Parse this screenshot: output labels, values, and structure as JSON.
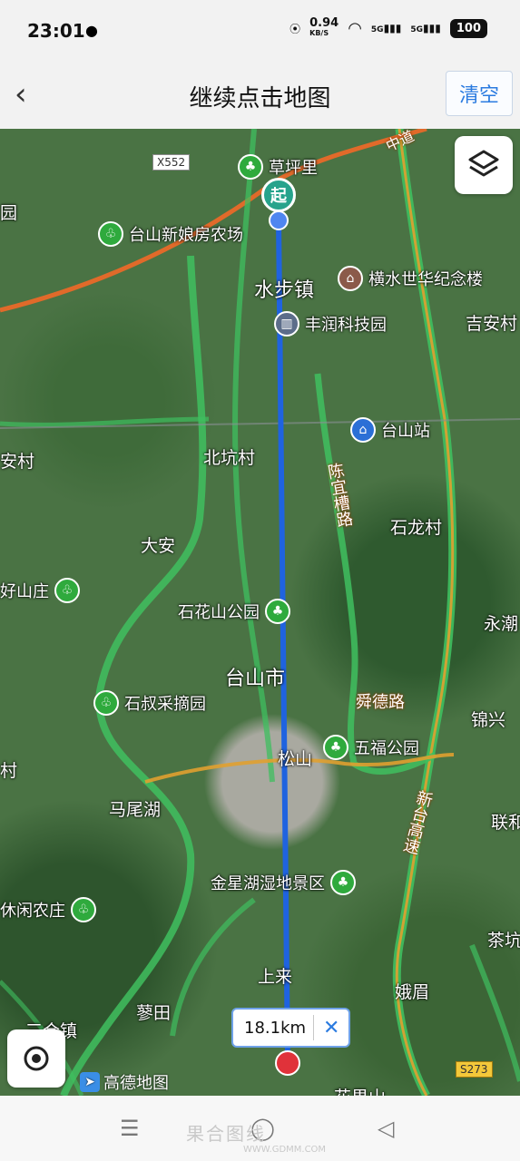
{
  "status": {
    "time": "23:01",
    "speed_value": "0.94",
    "speed_unit": "KB/S",
    "net1": "5G",
    "net2": "5G",
    "battery": "100"
  },
  "header": {
    "title": "继续点击地图",
    "clear_label": "清空"
  },
  "map": {
    "start_label": "起",
    "distance": "18.1km",
    "places": {
      "shuibu": "水步镇",
      "beikeng": "北坑村",
      "daan": "大安",
      "taishan": "台山市",
      "songshan": "松山",
      "maweihu": "马尾湖",
      "shanglai": "上来",
      "liaotian": "蓼田",
      "ejin": "娥眉",
      "shilong": "石龙村",
      "jian": "吉安村",
      "yongchao": "永潮",
      "jinxing": "锦兴",
      "lianhe": "联和",
      "chakeng": "茶坑",
      "sanhe": "三合镇",
      "huaguo": "花果山",
      "left1": "园",
      "left2": "安村",
      "left3": "村",
      "left4": "好山庄",
      "left5": "休闲农庄"
    },
    "pois": {
      "caopingli": "草坪里",
      "xinniang": "台山新娘房农场",
      "hengshui": "横水世华纪念楼",
      "fengrun": "丰润科技园",
      "taishanzhan": "台山站",
      "shihuashan": "石花山公园",
      "shishu": "石叔采摘园",
      "wufu": "五福公园",
      "jinxinghu": "金星湖湿地景区"
    },
    "roads": {
      "chenyi": "陈宜槽路",
      "shunde": "舜德路",
      "xintai": "新台高速",
      "top": "中道"
    },
    "shields": {
      "x552": "X552",
      "s273": "S273"
    },
    "logo": "高德地图"
  },
  "watermark": {
    "main": "果合图线",
    "url": "WWW.GDMM.COM"
  }
}
